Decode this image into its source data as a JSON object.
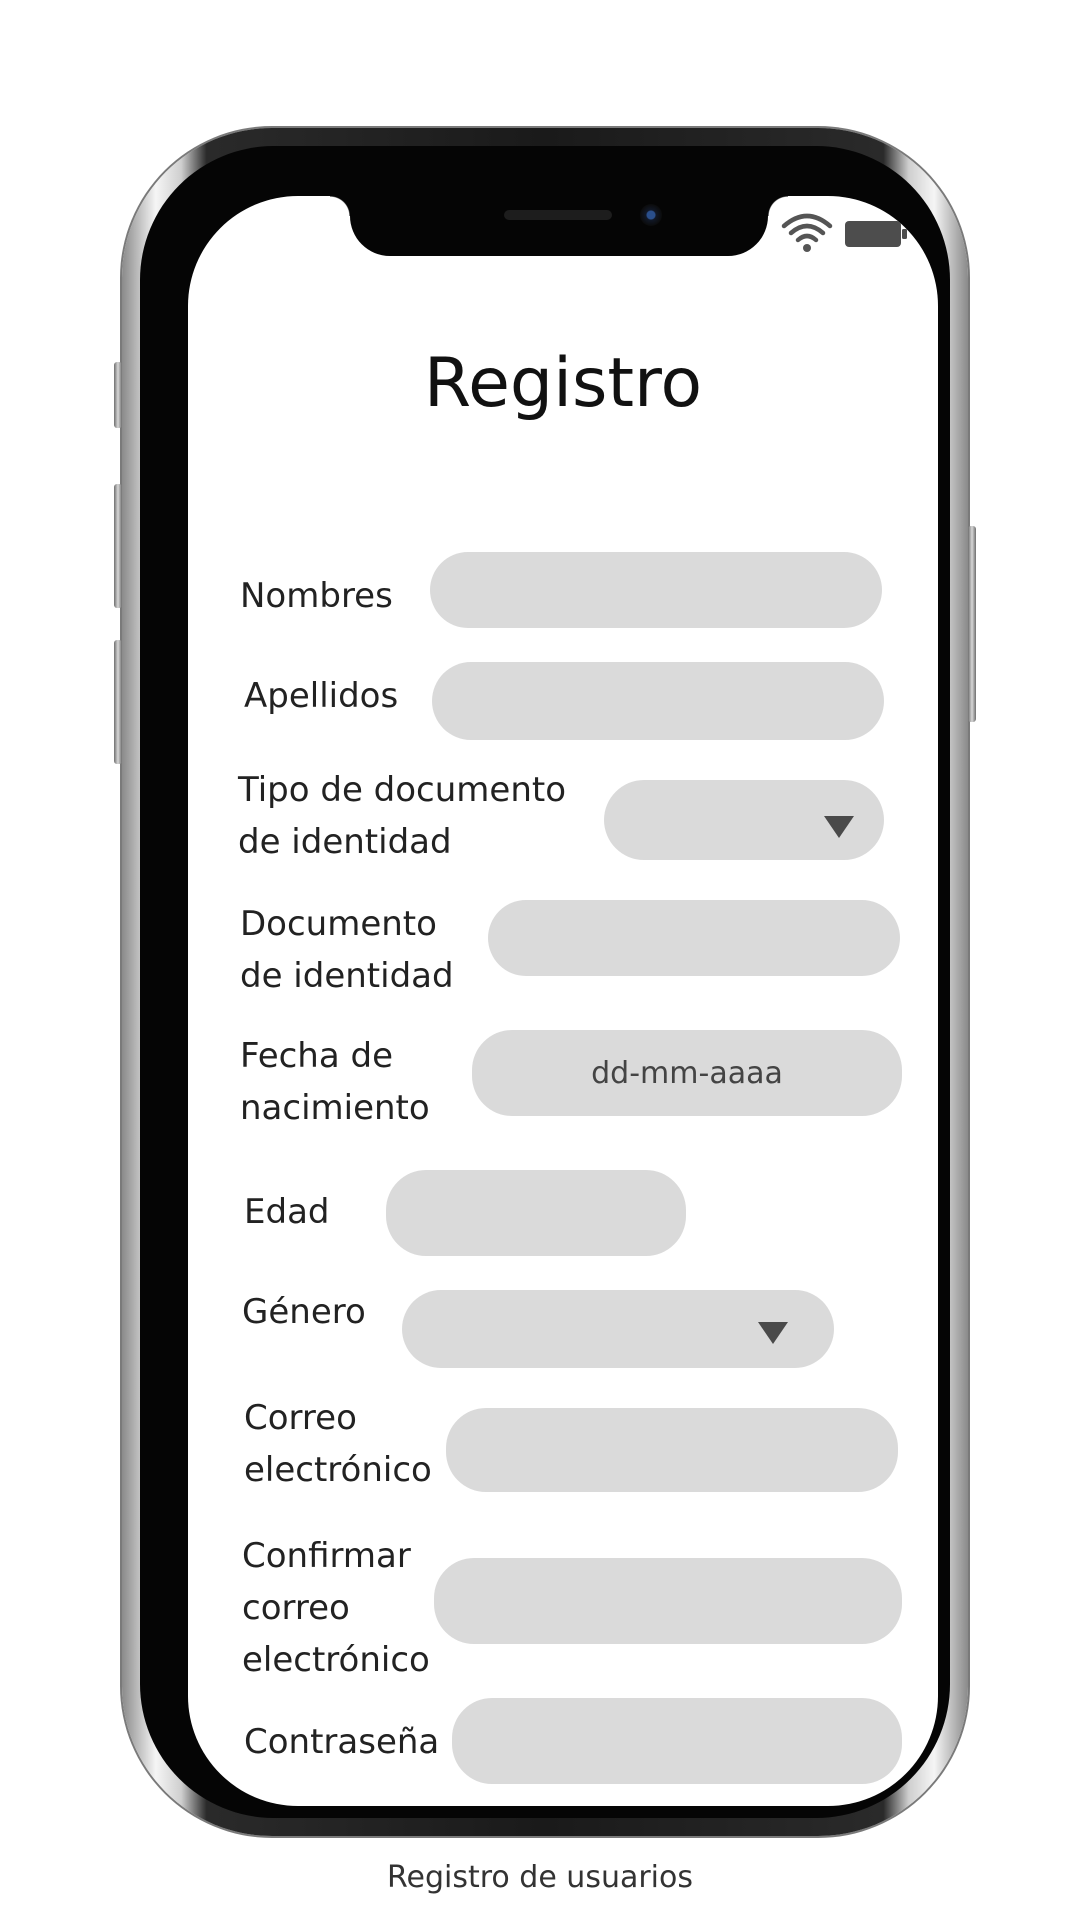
{
  "form": {
    "title": "Registro",
    "fields": {
      "nombres": {
        "label": "Nombres"
      },
      "apellidos": {
        "label": "Apellidos"
      },
      "tipo_documento": {
        "label_line1": "Tipo de documento",
        "label_line2": "de identidad"
      },
      "documento": {
        "label_line1": "Documento",
        "label_line2": "de identidad"
      },
      "fecha_nacimiento": {
        "label_line1": "Fecha de",
        "label_line2": "nacimiento",
        "placeholder": "dd-mm-aaaa"
      },
      "edad": {
        "label": "Edad"
      },
      "genero": {
        "label": "Género"
      },
      "correo": {
        "label_line1": "Correo",
        "label_line2": "electrónico"
      },
      "confirmar_correo": {
        "label_line1": "Confirmar",
        "label_line2": "correo",
        "label_line3": "electrónico"
      },
      "contrasena": {
        "label": "Contraseña"
      }
    }
  },
  "status_bar": {
    "icons": [
      "wifi-icon",
      "battery-icon"
    ]
  },
  "caption": "Registro de usuarios",
  "colors": {
    "field_fill": "#dadada",
    "caret": "#4a4a4a",
    "frame": "#050505"
  }
}
